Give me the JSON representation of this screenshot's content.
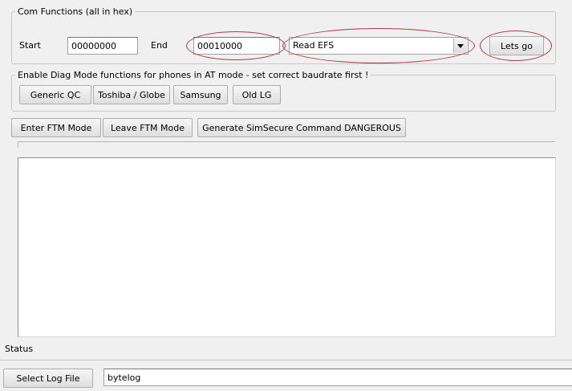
{
  "com_functions": {
    "legend": "Com Functions (all in hex)",
    "start_label": "Start",
    "start_value": "00000000",
    "end_label": "End",
    "end_value": "00010000",
    "action_selected": "Read EFS",
    "go_label": "Lets go"
  },
  "diag": {
    "legend": "Enable Diag Mode functions for phones in AT mode - set correct baudrate first !",
    "buttons": [
      "Generic QC",
      "Toshiba / Globe",
      "Samsung",
      "Old LG"
    ]
  },
  "ftm": {
    "buttons": [
      "Enter FTM Mode",
      "Leave FTM Mode",
      "Generate SimSecure Command DANGEROUS"
    ]
  },
  "status": {
    "label": "Status"
  },
  "log": {
    "select_label": "Select Log File",
    "file_value": "bytelog"
  },
  "colors": {
    "annotation": "#b0363f",
    "panel": "#f0f0f0"
  },
  "icons": {
    "dropdown": "chevron-down-icon"
  }
}
